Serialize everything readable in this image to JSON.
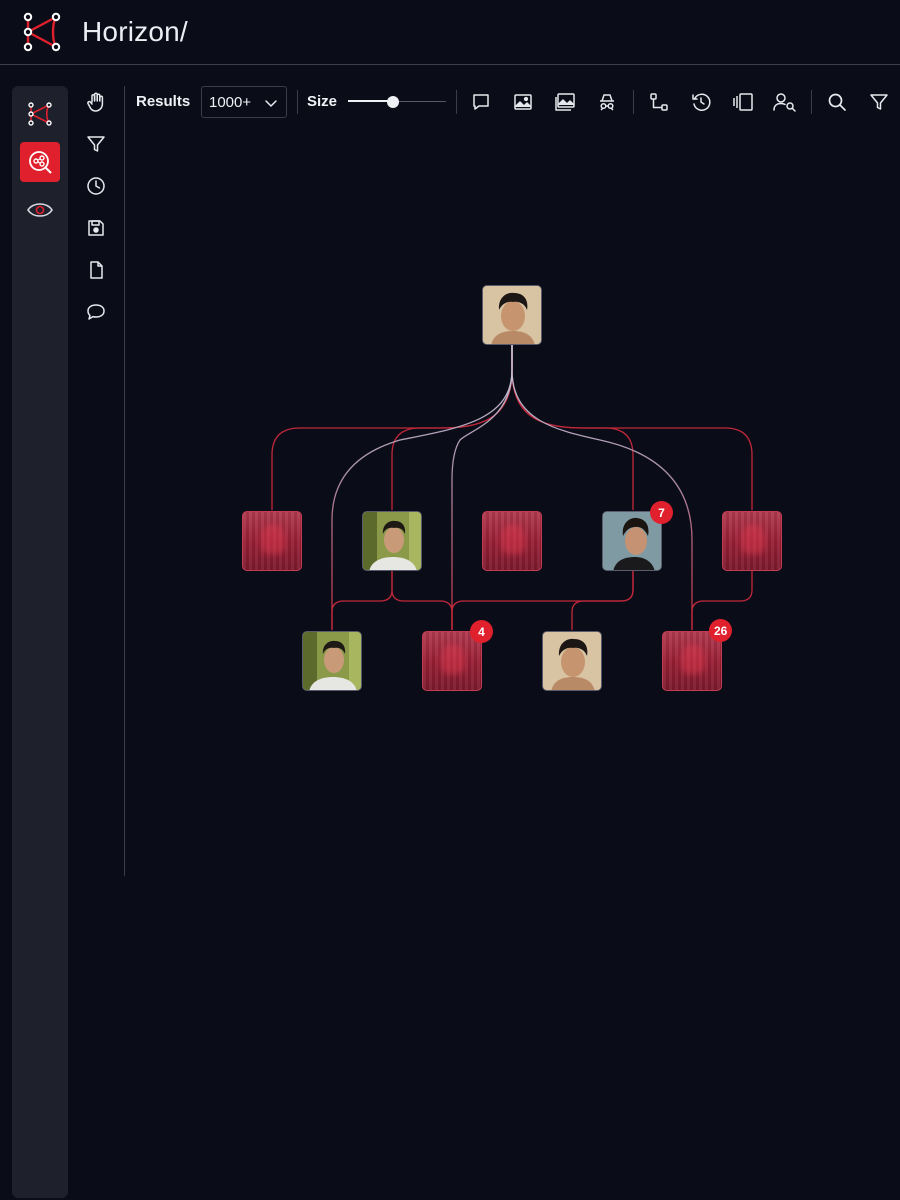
{
  "app": {
    "title": "Horizon/"
  },
  "colors": {
    "accent": "#e0202d",
    "background": "#0a0c18",
    "rail": "#1e202c",
    "edge_red": "#c2283a",
    "edge_light": "#b9bdd0"
  },
  "rail": {
    "items": [
      {
        "name": "graph-logo-icon",
        "active": false
      },
      {
        "name": "network-search-icon",
        "active": true
      },
      {
        "name": "eye-icon",
        "active": false
      }
    ]
  },
  "tools": {
    "items": [
      "hand-icon",
      "filter-icon",
      "clock-icon",
      "save-icon",
      "document-icon",
      "comment-icon"
    ]
  },
  "toolbar": {
    "results_label": "Results",
    "results_value": "1000+",
    "size_label": "Size",
    "size_level": 0.46,
    "icons": [
      "comment-icon",
      "image-icon",
      "images-icon",
      "incognito-icon",
      "flow-icon",
      "history-icon",
      "columns-icon",
      "person-search-icon",
      "search-icon",
      "filter-icon"
    ]
  },
  "graph": {
    "root": {
      "kind": "photo",
      "desc": "portrait-beige"
    },
    "level1": [
      {
        "kind": "redacted"
      },
      {
        "kind": "photo",
        "desc": "portrait-outdoor"
      },
      {
        "kind": "redacted"
      },
      {
        "kind": "photo",
        "desc": "portrait-side",
        "badge": "7"
      },
      {
        "kind": "redacted"
      }
    ],
    "level2": [
      {
        "kind": "photo",
        "desc": "portrait-outdoor"
      },
      {
        "kind": "redacted",
        "badge": "4"
      },
      {
        "kind": "photo",
        "desc": "portrait-beige"
      },
      {
        "kind": "redacted",
        "badge": "26"
      }
    ]
  }
}
